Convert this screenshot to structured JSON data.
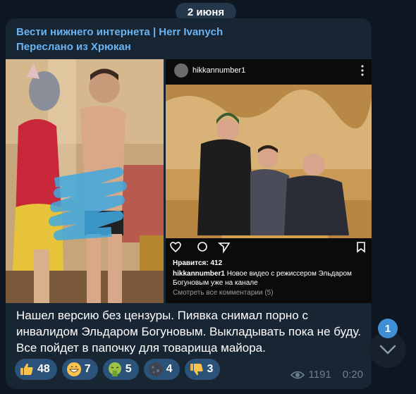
{
  "date_separator": "2 июня",
  "message": {
    "channel_name": "Вести нижнего интернета | Herr Ivanych",
    "forwarded_from": "Переслано из Хрюкан",
    "caption": "Нашел версию без цензуры. Пиявка снимал порно с инвалидом Эльдаром Богуновым. Выкладывать пока не буду. Все пойдет в папочку для товарища майора.",
    "views": "1191",
    "time": "0:20"
  },
  "instagram_post": {
    "username": "hikkannumber1",
    "likes": "Нравится: 412",
    "description_author": "hikkannumber1",
    "description_text": "Новое видео с режиссером Эльдаром Богуновым уже на канале",
    "comments_link": "Смотреть все комментарии (5)"
  },
  "reactions": [
    {
      "emoji": "thumbs-up",
      "count": "48"
    },
    {
      "emoji": "grinning-face",
      "count": "7"
    },
    {
      "emoji": "vomiting-face",
      "count": "5"
    },
    {
      "emoji": "new-moon-face",
      "count": "4"
    },
    {
      "emoji": "thumbs-down",
      "count": "3"
    }
  ],
  "scroll_down": {
    "unread_count": "1"
  },
  "colors": {
    "background": "#0e1621",
    "bubble": "#182533",
    "accent_link": "#6ab3f3",
    "reaction_bg": "#2b5278",
    "meta_text": "#6d7f8f",
    "badge": "#3e8fd3"
  }
}
